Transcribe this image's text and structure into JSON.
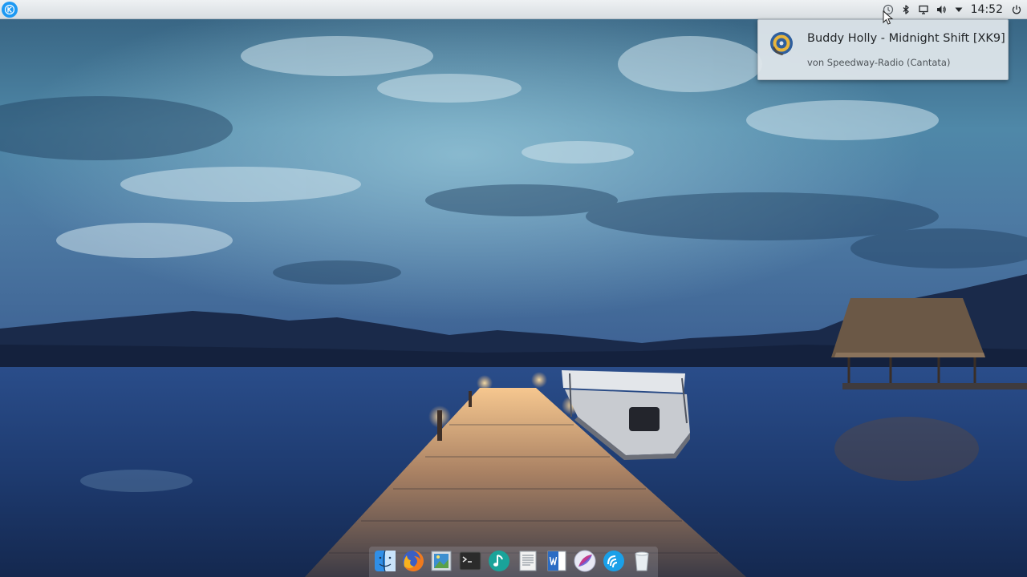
{
  "top_panel": {
    "launcher_icon": "kde-logo-icon",
    "tray_icons": [
      "notifications-icon",
      "bluetooth-icon",
      "display-icon",
      "volume-icon",
      "expand-tray-icon"
    ],
    "clock": "14:52",
    "power_icon": "power-icon"
  },
  "notification": {
    "icon": "music-disc-icon",
    "title": "Buddy Holly - Midnight Shift [XK9]",
    "body": "von Speedway-Radio (Cantata)"
  },
  "dock": {
    "items": [
      {
        "name": "file-manager",
        "icon": "finder-icon",
        "color": "#2f8fe8"
      },
      {
        "name": "firefox",
        "icon": "firefox-icon",
        "color": "#e66000"
      },
      {
        "name": "image-viewer",
        "icon": "image-viewer-icon",
        "color": "#3d8fd0"
      },
      {
        "name": "terminal",
        "icon": "terminal-icon",
        "color": "#2b2b2b"
      },
      {
        "name": "music-player",
        "icon": "music-note-icon",
        "color": "#1aa39a"
      },
      {
        "name": "text-editor",
        "icon": "text-editor-icon",
        "color": "#f2f2f2"
      },
      {
        "name": "word-processor",
        "icon": "word-processor-icon",
        "color": "#2b6cc4"
      },
      {
        "name": "web-browser",
        "icon": "browser-icon",
        "color": "#c13b8e"
      },
      {
        "name": "download-manager",
        "icon": "download-manager-icon",
        "color": "#1aa0e8"
      },
      {
        "name": "trash",
        "icon": "trash-icon",
        "color": "#e8eef2"
      }
    ]
  },
  "colors": {
    "panel_bg": "#e3e8ec",
    "kde_blue": "#1d99f3",
    "notification_bg": "#e1e7ec"
  }
}
